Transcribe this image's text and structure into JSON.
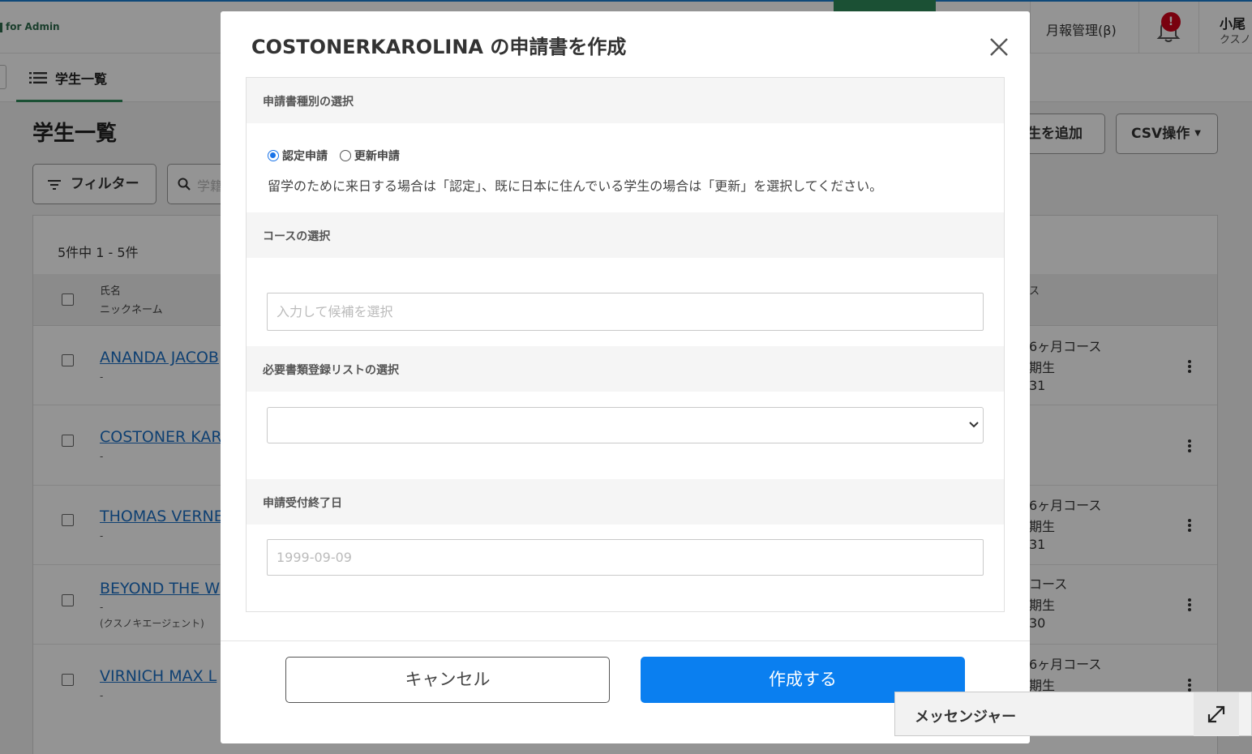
{
  "app": {
    "brand": "for Admin",
    "top_menu": "月報管理(β)",
    "notification_badge": "!",
    "user_name": "小尾",
    "user_sub": "クスノ"
  },
  "subnav": {
    "tab_label": "学生一覧"
  },
  "page": {
    "title": "学生一覧",
    "filter_label": "フィルター",
    "search_placeholder": "学籍",
    "add_label": "生を追加",
    "csv_label": "CSV操作",
    "count_text": "5件中 1 - 5件"
  },
  "table": {
    "headers": {
      "name": "氏名",
      "nickname": "ニックネーム",
      "course": "ス"
    },
    "rows": [
      {
        "name": "ANANDA JACOB",
        "nick": "-",
        "sub": "",
        "c1": "6ヶ月コース",
        "c2": "期生",
        "c3": "31"
      },
      {
        "name": "COSTONER KAR",
        "nick": "-",
        "sub": "",
        "c1": "",
        "c2": "",
        "c3": ""
      },
      {
        "name": "THOMAS VERNE",
        "nick": "-",
        "sub": "",
        "c1": "6ヶ月コース",
        "c2": "期生",
        "c3": "31"
      },
      {
        "name": "BEYOND THE W",
        "nick": "-",
        "sub": "(クスノキエージェント)",
        "c1": "コース",
        "c2": "期生",
        "c3": "30"
      },
      {
        "name": "VIRNICH MAX L",
        "nick": "-",
        "sub": "",
        "c1": "6ヶ月コース",
        "c2": "期生",
        "c3": ""
      }
    ]
  },
  "modal": {
    "title": "COSTONERKAROLINA の申請書を作成",
    "sections": {
      "type": "申請書種別の選択",
      "course": "コースの選択",
      "docs": "必要書類登録リストの選択",
      "deadline": "申請受付終了日"
    },
    "radio_options": [
      {
        "label": "認定申請",
        "checked": true
      },
      {
        "label": "更新申請",
        "checked": false
      }
    ],
    "help_text": "留学のために来日する場合は「認定」、既に日本に住んでいる学生の場合は「更新」を選択してください。",
    "course_placeholder": "入力して候補を選択",
    "docs_value": "",
    "date_placeholder": "1999-09-09",
    "cancel_label": "キャンセル",
    "create_label": "作成する"
  },
  "messenger": {
    "label": "メッセンジャー"
  },
  "colors": {
    "primary": "#0a7ff0",
    "brand_green": "#2f8b5a",
    "link": "#1a6fc4",
    "badge": "#d0021b"
  }
}
